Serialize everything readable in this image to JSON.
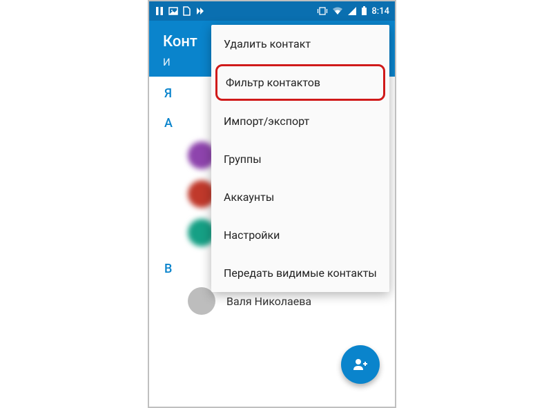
{
  "status_bar": {
    "time": "8:14"
  },
  "header": {
    "title_visible": "Конт",
    "tab_visible": "И"
  },
  "menu": {
    "items": [
      "Удалить контакт",
      "Фильтр контактов",
      "Импорт/экспорт",
      "Группы",
      "Аккаунты",
      "Настройки",
      "Передать видимые контакты"
    ],
    "highlighted_index": 1
  },
  "sections": [
    {
      "letter": "Я",
      "contacts": []
    },
    {
      "letter": "А",
      "contacts": [
        {
          "name": "",
          "blurred": true,
          "color": "#8e44ad"
        },
        {
          "name": "",
          "blurred": true,
          "color": "#c0392b"
        },
        {
          "name": "",
          "blurred": true,
          "color": "#16a085"
        }
      ]
    },
    {
      "letter": "В",
      "contacts": [
        {
          "name": "Валя Николаева",
          "blurred": false,
          "color": "#bdbdbd"
        }
      ]
    }
  ]
}
